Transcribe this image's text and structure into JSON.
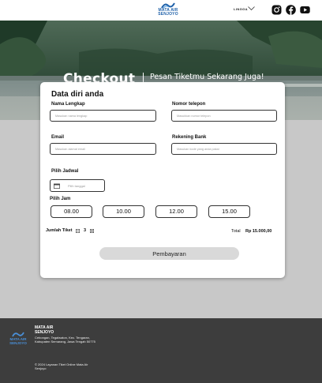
{
  "header": {
    "logo_line1": "MATA AIR",
    "logo_line2": "SENJOYO",
    "language_label": "LINGGA",
    "social": [
      "instagram-icon",
      "facebook-icon",
      "youtube-icon"
    ]
  },
  "hero": {
    "title": "Checkout",
    "subtitle": "Pesan Tiketmu Sekarang Juga!"
  },
  "form": {
    "title": "Data diri anda",
    "name_label": "Nama Lengkap",
    "name_placeholder": "Masukan nama lengkap",
    "phone_label": "Nomor telepon",
    "phone_placeholder": "Masukkan nomor telepon",
    "email_label": "Email",
    "email_placeholder": "Masukan alamat email",
    "bank_label": "Rekening Bank",
    "bank_placeholder": "Masukan kode yang anda pakai",
    "schedule_label": "Pilih Jadwal",
    "date_placeholder": "Pilih tanggal",
    "time_label": "Pilih Jam",
    "times": [
      "08.00",
      "10.00",
      "12.00",
      "15.00"
    ],
    "qty_label": "Jumlah Tiket",
    "qty_value": "3",
    "total_label": "Total",
    "total_value": "Rp 15.000,00",
    "pay_button": "Pembayaran"
  },
  "footer": {
    "logo_line1": "MATA AIR",
    "logo_line2": "SENJOYO",
    "name_line1": "MATA AIR",
    "name_line2": "SENJOYO",
    "address": "Cebongan, Tegalwaton, Kec. Tengaran, Kabupaten Semarang, Jawa Tengah 50775",
    "copyright": "© 2024 Layanan Tiket Online Mata Air Senjoyo"
  },
  "colors": {
    "brand_blue": "#1d5fa8",
    "footer_bg": "#3d3d3d",
    "page_bg": "#c8c8c8",
    "button_bg": "#d9d9d9"
  }
}
